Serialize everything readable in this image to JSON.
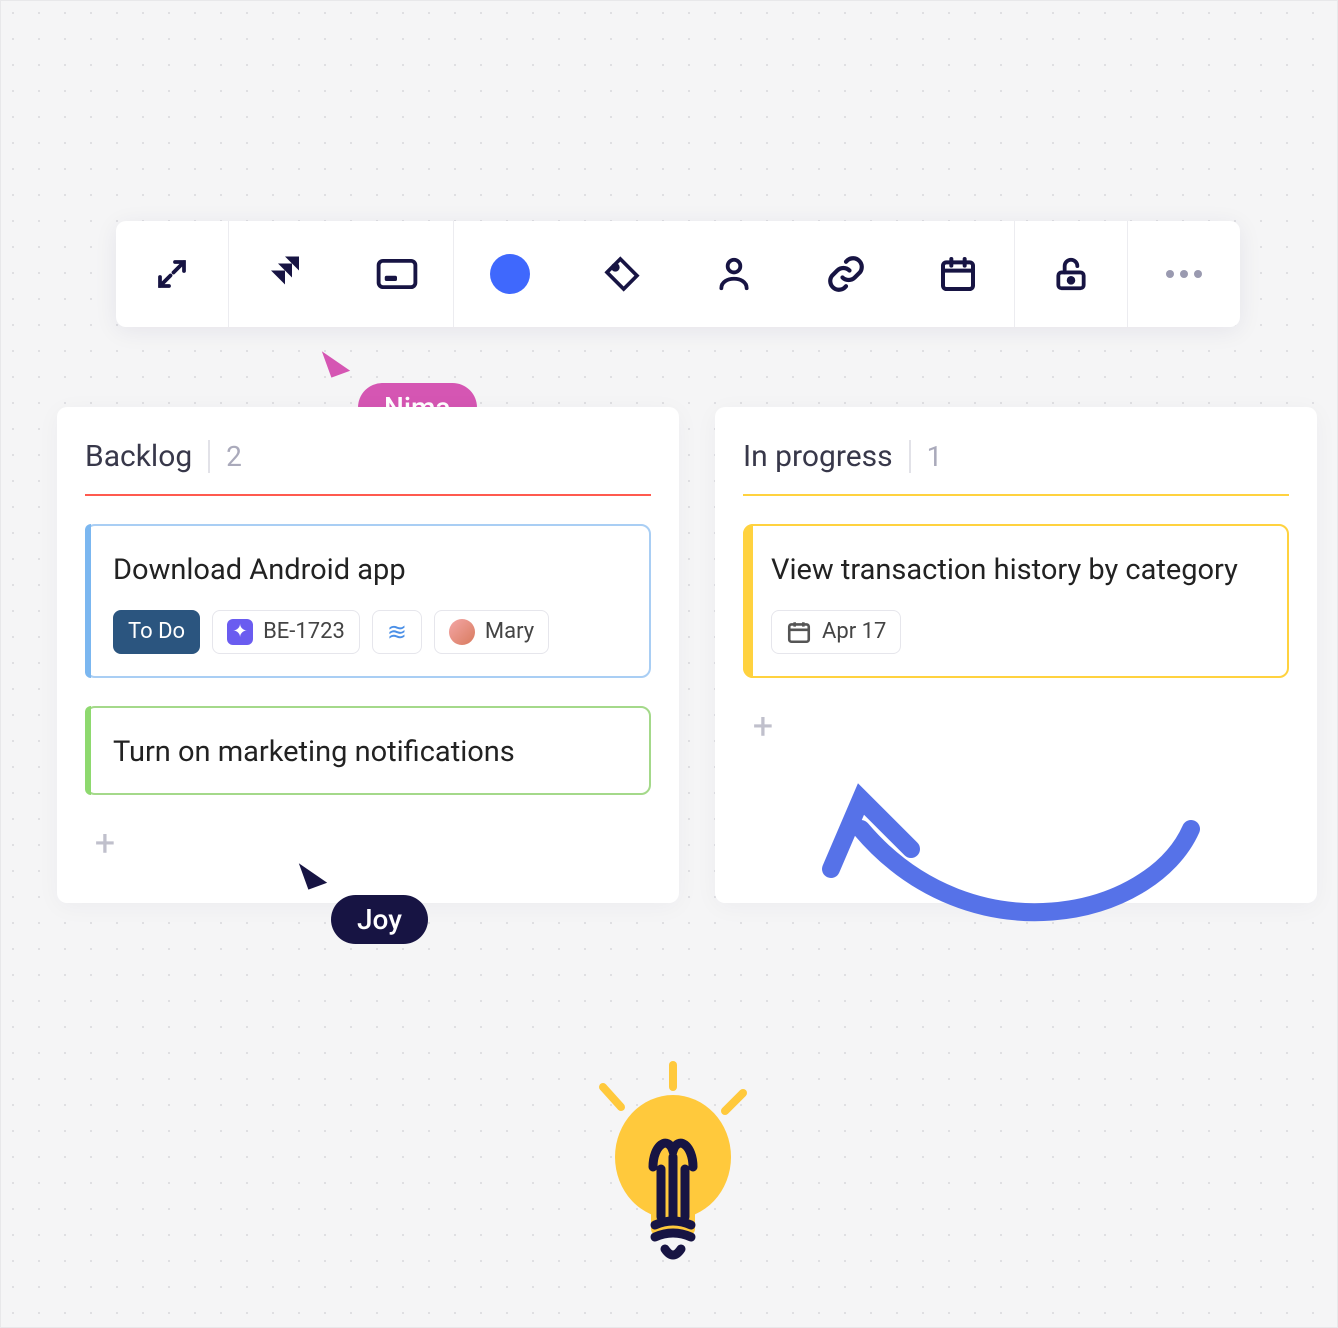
{
  "toolbar": {
    "items": [
      {
        "name": "expand-icon"
      },
      {
        "name": "jira-icon"
      },
      {
        "name": "card-icon"
      },
      {
        "name": "color-dot"
      },
      {
        "name": "tag-icon"
      },
      {
        "name": "person-icon"
      },
      {
        "name": "link-icon"
      },
      {
        "name": "calendar-icon"
      },
      {
        "name": "unlock-icon"
      },
      {
        "name": "more-icon"
      }
    ]
  },
  "cursors": {
    "nima": "Nima",
    "joy": "Joy"
  },
  "columns": [
    {
      "title": "Backlog",
      "count": "2",
      "color": "red",
      "cards": [
        {
          "color": "blue",
          "title": "Download Android app",
          "badges": {
            "status": "To Do",
            "ticket": "BE-1723",
            "assignee": "Mary"
          }
        },
        {
          "color": "green",
          "title": "Turn on marketing notifications"
        }
      ]
    },
    {
      "title": "In progress",
      "count": "1",
      "color": "yellow",
      "cards": [
        {
          "color": "yellow",
          "title": "View transaction history by category",
          "date": "Apr 17"
        }
      ]
    }
  ]
}
